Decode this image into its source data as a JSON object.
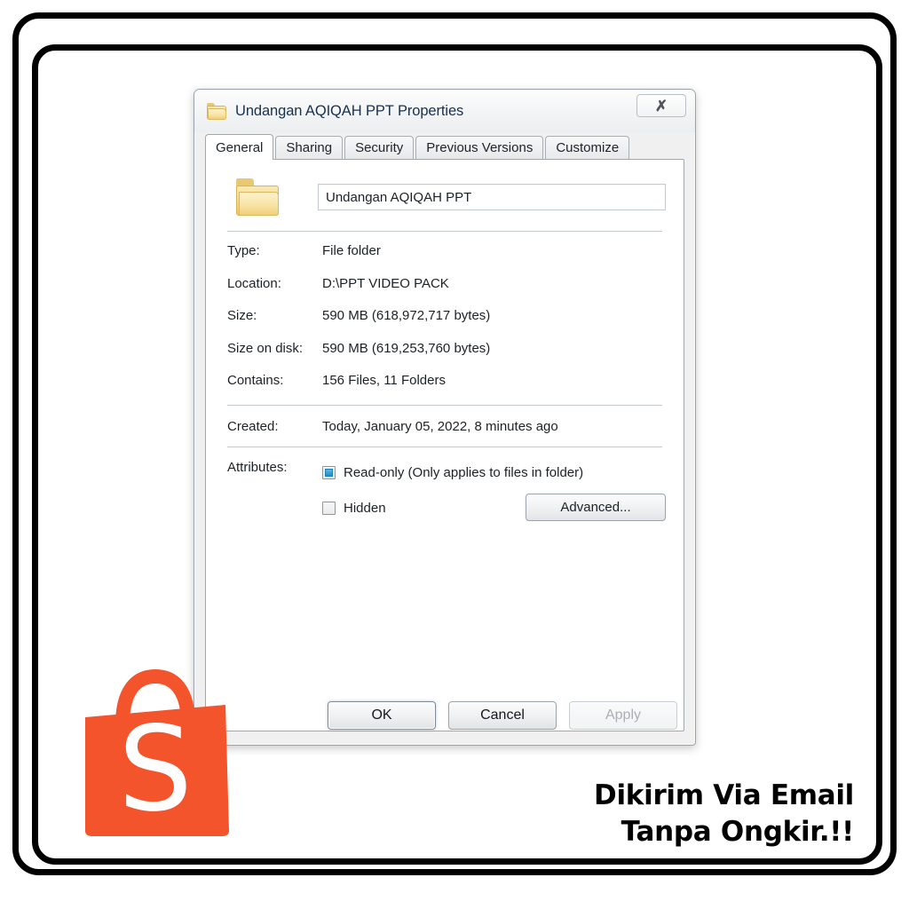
{
  "dialog": {
    "title": "Undangan AQIQAH PPT Properties",
    "title_icon": "folder-icon",
    "close_label": "⌧",
    "tabs": [
      {
        "label": "General",
        "active": true
      },
      {
        "label": "Sharing",
        "active": false
      },
      {
        "label": "Security",
        "active": false
      },
      {
        "label": "Previous Versions",
        "active": false
      },
      {
        "label": "Customize",
        "active": false
      }
    ],
    "name_field": {
      "value": "Undangan AQIQAH PPT",
      "placeholder": "Folder name"
    },
    "properties": [
      {
        "label": "Type:",
        "value": "File folder"
      },
      {
        "label": "Location:",
        "value": "D:\\PPT VIDEO PACK"
      },
      {
        "label": "Size:",
        "value": "590 MB (618,972,717 bytes)"
      },
      {
        "label": "Size on disk:",
        "value": "590 MB (619,253,760 bytes)"
      },
      {
        "label": "Contains:",
        "value": "156 Files, 11 Folders"
      }
    ],
    "created": {
      "label": "Created:",
      "value": "Today, January 05, 2022, 8 minutes ago"
    },
    "attributes": {
      "label": "Attributes:",
      "readonly": {
        "text": "Read-only (Only applies to files in folder)",
        "state": "indeterminate"
      },
      "hidden": {
        "text": "Hidden",
        "state": "unchecked"
      },
      "advanced_label": "Advanced..."
    },
    "footer": {
      "ok_label": "OK",
      "cancel_label": "Cancel",
      "apply_label": "Apply",
      "apply_disabled": true
    }
  },
  "promo": {
    "line1": "Dikirim Via Email",
    "line2": "Tanpa Ongkir.!!"
  },
  "logo": {
    "name": "shopee-bag-logo",
    "letter": "S",
    "bag_color": "#F4542C",
    "letter_color": "#FFFFFF"
  },
  "colors": {
    "frame": "#000000",
    "accent_blue": "#1F8EC4",
    "dialog_bg": "#F0F0F0",
    "title_text": "#16314F"
  }
}
